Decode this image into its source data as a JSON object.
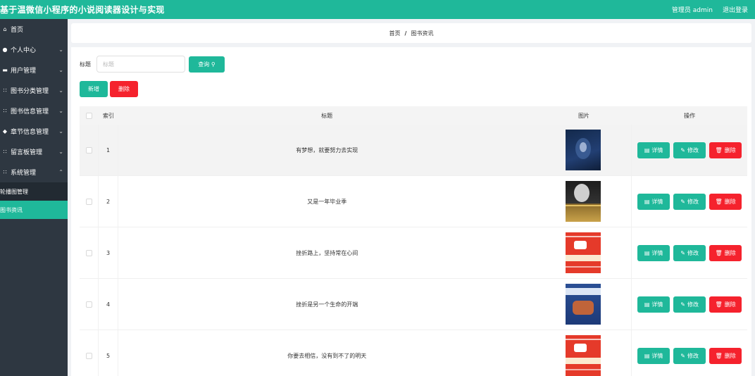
{
  "header": {
    "app_title": "基于温微信小程序的小说阅读器设计与实现",
    "user_label": "管理员 admin",
    "logout_label": "退出登录"
  },
  "sidebar": {
    "items": [
      {
        "label": "首页",
        "icon": "home-icon",
        "has_submenu": false
      },
      {
        "label": "个人中心",
        "icon": "user-icon",
        "has_submenu": true
      },
      {
        "label": "用户管理",
        "icon": "list-icon",
        "has_submenu": true
      },
      {
        "label": "图书分类管理",
        "icon": "grid-icon",
        "has_submenu": true
      },
      {
        "label": "图书信息管理",
        "icon": "grid-icon",
        "has_submenu": true
      },
      {
        "label": "章节信息管理",
        "icon": "chapter-icon",
        "has_submenu": true
      },
      {
        "label": "留言板管理",
        "icon": "grid-icon",
        "has_submenu": true
      },
      {
        "label": "系统管理",
        "icon": "grid-icon",
        "has_submenu": true,
        "expanded": true
      }
    ],
    "submenu": [
      {
        "label": "轮播图管理",
        "active": false
      },
      {
        "label": "图书资讯",
        "active": true
      }
    ]
  },
  "breadcrumb": {
    "home": "首页",
    "separator": "/",
    "current": "图书资讯"
  },
  "search": {
    "label": "标题",
    "placeholder": "标题",
    "button_label": "查询"
  },
  "actions": {
    "add_label": "新增",
    "delete_label": "删除"
  },
  "table": {
    "columns": [
      "索引",
      "标题",
      "图片",
      "操作"
    ],
    "op_labels": {
      "detail": "详情",
      "edit": "修改",
      "delete": "删除"
    },
    "rows": [
      {
        "index": "1",
        "title": "有梦想，就要努力去实现",
        "cover": "blue-dark"
      },
      {
        "index": "2",
        "title": "又是一年毕业季",
        "cover": "black"
      },
      {
        "index": "3",
        "title": "挫折路上，坚持常在心间",
        "cover": "red"
      },
      {
        "index": "4",
        "title": "挫折是另一个生命的开端",
        "cover": "blue"
      },
      {
        "index": "5",
        "title": "你要去相信，没有到不了的明天",
        "cover": "red"
      }
    ]
  },
  "colors": {
    "primary": "#1fb89a",
    "danger": "#f5222d",
    "sidebar_bg": "#2e3741"
  }
}
